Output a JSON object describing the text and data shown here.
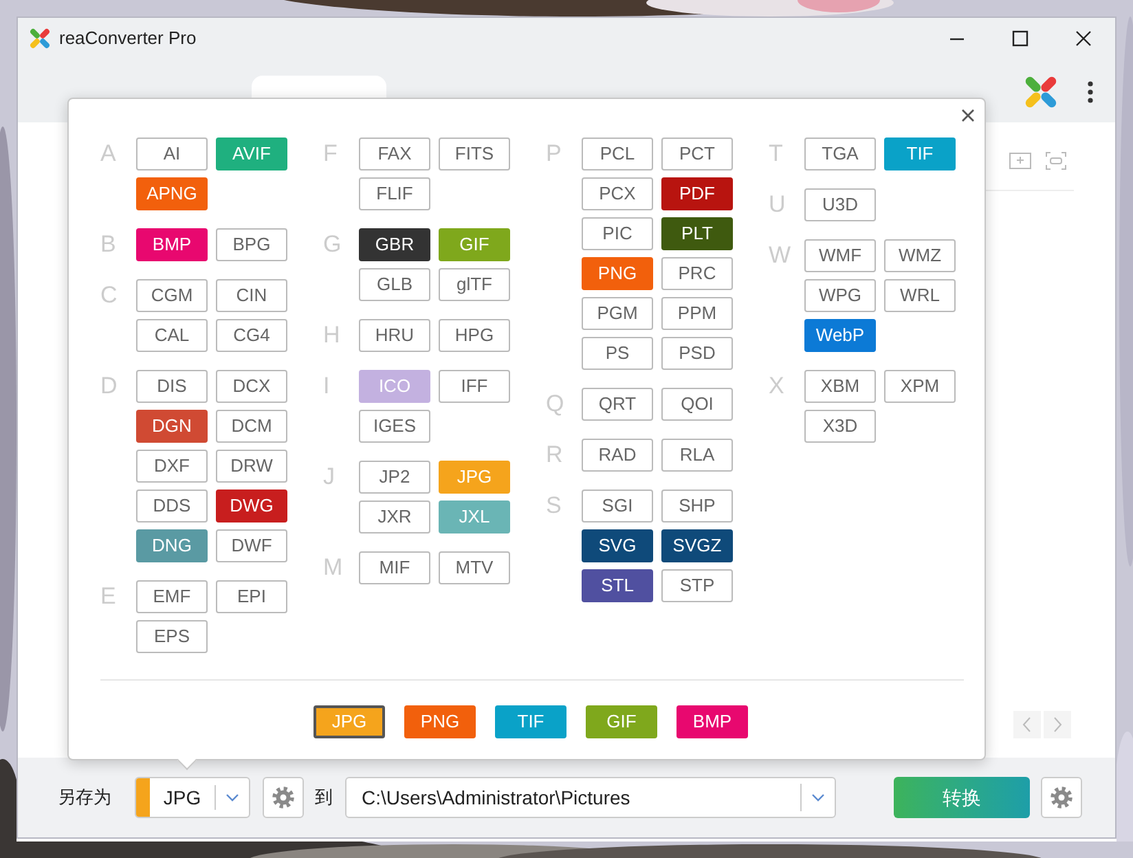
{
  "window": {
    "title": "reaConverter Pro"
  },
  "tabs": [
    {
      "selected": true
    }
  ],
  "format_picker": {
    "columns": [
      [
        {
          "letter": "A",
          "formats": [
            {
              "label": "AI"
            },
            {
              "label": "AVIF",
              "color": "#1fb07f"
            },
            {
              "label": "APNG",
              "color": "#f2600c"
            }
          ]
        },
        {
          "letter": "B",
          "formats": [
            {
              "label": "BMP",
              "color": "#e8086f"
            },
            {
              "label": "BPG"
            }
          ]
        },
        {
          "letter": "C",
          "formats": [
            {
              "label": "CGM"
            },
            {
              "label": "CIN"
            },
            {
              "label": "CAL"
            },
            {
              "label": "CG4"
            }
          ]
        },
        {
          "letter": "D",
          "formats": [
            {
              "label": "DIS"
            },
            {
              "label": "DCX"
            },
            {
              "label": "DGN",
              "color": "#d04a33"
            },
            {
              "label": "DCM"
            },
            {
              "label": "DXF"
            },
            {
              "label": "DRW"
            },
            {
              "label": "DDS"
            },
            {
              "label": "DWG",
              "color": "#c81e1e"
            },
            {
              "label": "DNG",
              "color": "#5a9aa3"
            },
            {
              "label": "DWF"
            }
          ]
        },
        {
          "letter": "E",
          "formats": [
            {
              "label": "EMF"
            },
            {
              "label": "EPI"
            },
            {
              "label": "EPS"
            }
          ]
        }
      ],
      [
        {
          "letter": "F",
          "formats": [
            {
              "label": "FAX"
            },
            {
              "label": "FITS"
            },
            {
              "label": "FLIF"
            }
          ]
        },
        {
          "letter": "G",
          "formats": [
            {
              "label": "GBR",
              "color": "#333333"
            },
            {
              "label": "GIF",
              "color": "#7fa81c"
            },
            {
              "label": "GLB"
            },
            {
              "label": "glTF"
            }
          ]
        },
        {
          "letter": "H",
          "formats": [
            {
              "label": "HRU"
            },
            {
              "label": "HPG"
            }
          ]
        },
        {
          "letter": "I",
          "formats": [
            {
              "label": "ICO",
              "color": "#c3b1e0"
            },
            {
              "label": "IFF"
            },
            {
              "label": "IGES"
            }
          ]
        },
        {
          "letter": "J",
          "formats": [
            {
              "label": "JP2"
            },
            {
              "label": "JPG",
              "color": "#f5a41c"
            },
            {
              "label": "JXR"
            },
            {
              "label": "JXL",
              "color": "#6ab5b5"
            }
          ]
        },
        {
          "letter": "M",
          "formats": [
            {
              "label": "MIF"
            },
            {
              "label": "MTV"
            }
          ]
        }
      ],
      [
        {
          "letter": "P",
          "formats": [
            {
              "label": "PCL"
            },
            {
              "label": "PCT"
            },
            {
              "label": "PCX"
            },
            {
              "label": "PDF",
              "color": "#b8140f"
            },
            {
              "label": "PIC"
            },
            {
              "label": "PLT",
              "color": "#3f5a0f"
            },
            {
              "label": "PNG",
              "color": "#f2600c"
            },
            {
              "label": "PRC"
            },
            {
              "label": "PGM"
            },
            {
              "label": "PPM"
            },
            {
              "label": "PS"
            },
            {
              "label": "PSD"
            }
          ]
        },
        {
          "letter": "Q",
          "formats": [
            {
              "label": "QRT"
            },
            {
              "label": "QOI"
            }
          ]
        },
        {
          "letter": "R",
          "formats": [
            {
              "label": "RAD"
            },
            {
              "label": "RLA"
            }
          ]
        },
        {
          "letter": "S",
          "formats": [
            {
              "label": "SGI"
            },
            {
              "label": "SHP"
            },
            {
              "label": "SVG",
              "color": "#0f4a7a"
            },
            {
              "label": "SVGZ",
              "color": "#0f4a7a"
            },
            {
              "label": "STL",
              "color": "#5050a0"
            },
            {
              "label": "STP"
            }
          ]
        }
      ],
      [
        {
          "letter": "T",
          "formats": [
            {
              "label": "TGA"
            },
            {
              "label": "TIF",
              "color": "#0aa2c8"
            }
          ]
        },
        {
          "letter": "U",
          "formats": [
            {
              "label": "U3D"
            }
          ]
        },
        {
          "letter": "W",
          "formats": [
            {
              "label": "WMF"
            },
            {
              "label": "WMZ"
            },
            {
              "label": "WPG"
            },
            {
              "label": "WRL"
            },
            {
              "label": "WebP",
              "color": "#0c7ad6"
            }
          ]
        },
        {
          "letter": "X",
          "formats": [
            {
              "label": "XBM"
            },
            {
              "label": "XPM"
            },
            {
              "label": "X3D"
            }
          ]
        }
      ]
    ],
    "recent": [
      {
        "label": "JPG",
        "color": "#f5a41c",
        "selected": true
      },
      {
        "label": "PNG",
        "color": "#f2600c",
        "selected": false
      },
      {
        "label": "TIF",
        "color": "#0aa2c8",
        "selected": false
      },
      {
        "label": "GIF",
        "color": "#7fa81c",
        "selected": false
      },
      {
        "label": "BMP",
        "color": "#e8086f",
        "selected": false
      }
    ]
  },
  "save_bar": {
    "save_as_label": "另存为",
    "format": {
      "label": "JPG",
      "color": "#f5a41c"
    },
    "to_label": "到",
    "folder": "C:\\Users\\Administrator\\Pictures",
    "convert_button": "转换"
  }
}
